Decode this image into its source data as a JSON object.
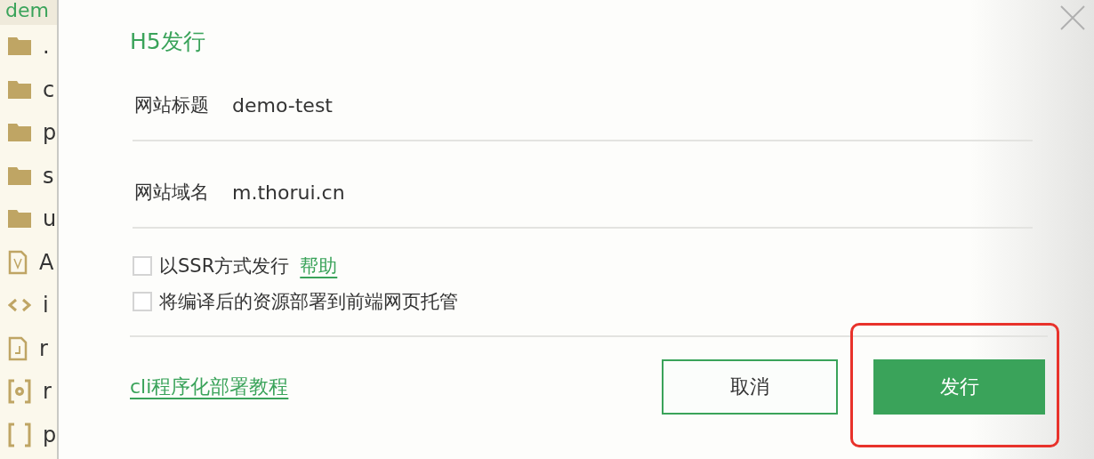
{
  "sidebar": {
    "header": "dem",
    "items": [
      {
        "kind": "folder",
        "label": "."
      },
      {
        "kind": "folder",
        "label": "c"
      },
      {
        "kind": "folder",
        "label": "p"
      },
      {
        "kind": "folder",
        "label": "s"
      },
      {
        "kind": "folder",
        "label": "u"
      },
      {
        "kind": "vue",
        "label": "A"
      },
      {
        "kind": "code",
        "label": "i"
      },
      {
        "kind": "json",
        "label": "r"
      },
      {
        "kind": "config",
        "label": "r"
      },
      {
        "kind": "brackets",
        "label": "p"
      }
    ]
  },
  "dialog": {
    "title": "H5发行",
    "fields": [
      {
        "label": "网站标题",
        "value": "demo-test"
      },
      {
        "label": "网站域名",
        "value": "m.thorui.cn"
      }
    ],
    "options": [
      {
        "label": "以SSR方式发行",
        "link": "帮助",
        "checked": false
      },
      {
        "label": "将编译后的资源部署到前端网页托管",
        "checked": false
      }
    ],
    "tutorial_link": "cli程序化部署教程",
    "buttons": [
      {
        "label": "取消",
        "kind": "secondary"
      },
      {
        "label": "发行",
        "kind": "primary"
      }
    ]
  }
}
